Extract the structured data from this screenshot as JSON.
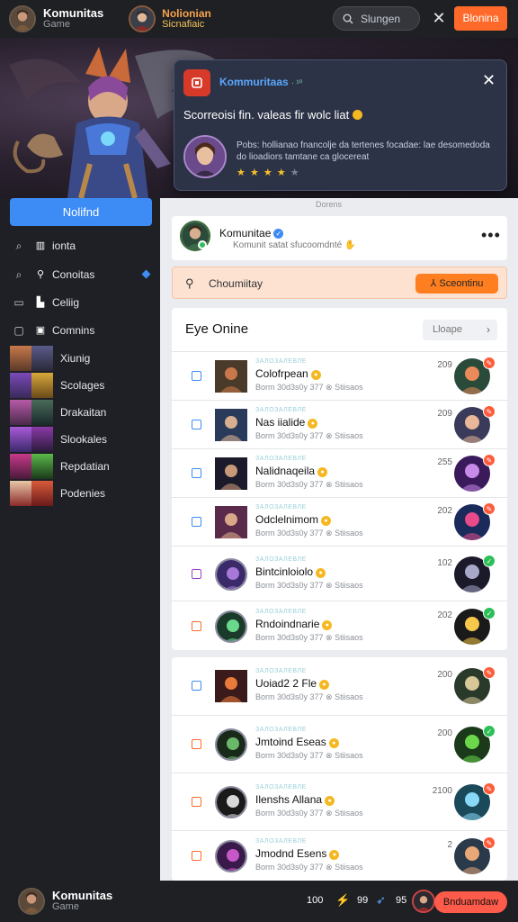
{
  "colors": {
    "accent_blue": "#3d8bf5",
    "accent_orange": "#ff6a2a",
    "sidebar_bg": "#1f2025",
    "main_bg": "#ebecef"
  },
  "topbar": {
    "brand_title": "Komunitas",
    "brand_sub": "Game",
    "user_name": "Nolionian",
    "user_status": "Sicnafiaic",
    "search_label": "Slungen",
    "cta_label": "Blonina"
  },
  "popup": {
    "title": "Kommuritaas",
    "title_mark": "· ¹⁰",
    "message": "Scorreoisi fin. valeas fir wolc liat",
    "description": "Pobs: hollianao fnancolje da tertenes focadae: lae desomedoda do lioadiors tamtane ca glocereat",
    "rating": 3.5,
    "rating_max": 5
  },
  "sidebar": {
    "primary_button": "Nolifnd",
    "nav": [
      {
        "icon": "search-icon",
        "label": "ionta"
      },
      {
        "icon": "search-icon",
        "label": "Conoitas"
      },
      {
        "icon": "panel-icon",
        "label": "Celiig"
      },
      {
        "icon": "square-icon",
        "label": "Comnins"
      }
    ],
    "games": [
      {
        "label": "Xiunig"
      },
      {
        "label": "Scolages"
      },
      {
        "label": "Drakaitan"
      },
      {
        "label": "Slookales"
      },
      {
        "label": "Repdatian"
      },
      {
        "label": "Podenies"
      }
    ]
  },
  "main": {
    "caption": "Dorens",
    "post": {
      "name": "Komunitae",
      "sub": "Komunit satat sfucoomdnté"
    },
    "search": {
      "placeholder": "Choumiitay",
      "button": "Sceontinu"
    },
    "list": {
      "title": "Eye Onine",
      "button": "Lloape"
    },
    "category_label": "ЗАЛОЗАЛЕВЛЕ",
    "meta_label": "Borm 30d3s0y 377 ⊗ Stiisaos",
    "rows": [
      {
        "name": "Colofrpean",
        "count": "209",
        "check_color": "#3d8bf5",
        "badge": "orange"
      },
      {
        "name": "Nas iialide",
        "count": "209",
        "check_color": "#3d8bf5",
        "badge": "orange"
      },
      {
        "name": "Nalidnaqeila",
        "count": "255",
        "check_color": "#3d8bf5",
        "badge": "orange"
      },
      {
        "name": "Odclelnimom",
        "count": "202",
        "check_color": "#3d8bf5",
        "badge": "orange"
      },
      {
        "name": "Bintcinloiolo",
        "count": "102",
        "check_color": "#a040c0",
        "badge": "green"
      },
      {
        "name": "Rndoindnarie",
        "count": "202",
        "check_color": "#ff6a2a",
        "badge": "green"
      },
      {
        "name": "Uoiad2 2 Fle",
        "count": "200",
        "check_color": "#3d8bf5",
        "badge": "orange"
      },
      {
        "name": "Jmtoind Eseas",
        "count": "200",
        "check_color": "#ff6a2a",
        "badge": "green"
      },
      {
        "name": "Ilenshs Allana",
        "count": "2100",
        "check_color": "#ff6a2a",
        "badge": "orange"
      },
      {
        "name": "Jmodnd Esens",
        "count": "2",
        "check_color": "#ff6a2a",
        "badge": "orange"
      }
    ]
  },
  "bottombar": {
    "brand_title": "Komunitas",
    "brand_sub": "Game",
    "stat_1": "100",
    "stat_2": "99",
    "stat_3": "95",
    "cta_label": "Bnduamdaw"
  }
}
